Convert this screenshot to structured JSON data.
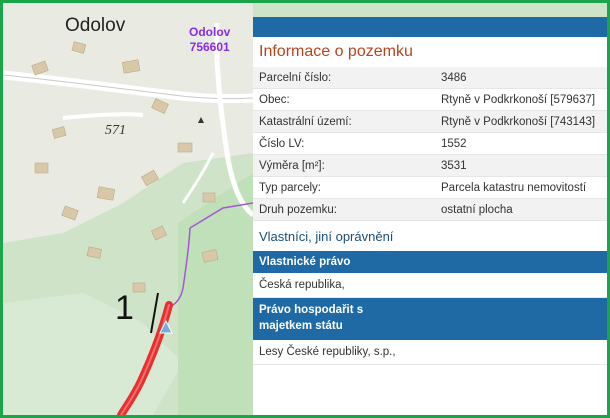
{
  "map": {
    "place_label": "Odolov",
    "cadastral_label_line1": "Odolov",
    "cadastral_label_line2": "756601",
    "elevation_label": "571",
    "parcel_marker_label": "1"
  },
  "panel": {
    "title": "Informace o pozemku",
    "rows": [
      {
        "key": "Parcelní číslo:",
        "value": "3486"
      },
      {
        "key": "Obec:",
        "value": "Rtyně v Podkrkonoší [579637]"
      },
      {
        "key": "Katastrální území:",
        "value": "Rtyně v Podkrkonoší [743143]"
      },
      {
        "key": "Číslo LV:",
        "value": "1552"
      },
      {
        "key": "Výměra [m²]:",
        "value": "3531"
      },
      {
        "key": "Typ parcely:",
        "value": "Parcela katastru nemovitostí"
      },
      {
        "key": "Druh pozemku:",
        "value": "ostatní plocha"
      }
    ],
    "owners_title": "Vlastníci, jiní oprávnění",
    "ownership_header": "Vlastnické právo",
    "ownership_value": "Česká republika,",
    "management_header_line1": "Právo hospodařit s",
    "management_header_line2": "majetkem státu",
    "management_value": "Lesy České republiky, s.p.,"
  },
  "colors": {
    "frame_border": "#1aa54b",
    "panel_header": "#1f6aa5",
    "title_text": "#b8431e",
    "parcel_line": "#e53030",
    "cadastral_text": "#8a2be2"
  }
}
